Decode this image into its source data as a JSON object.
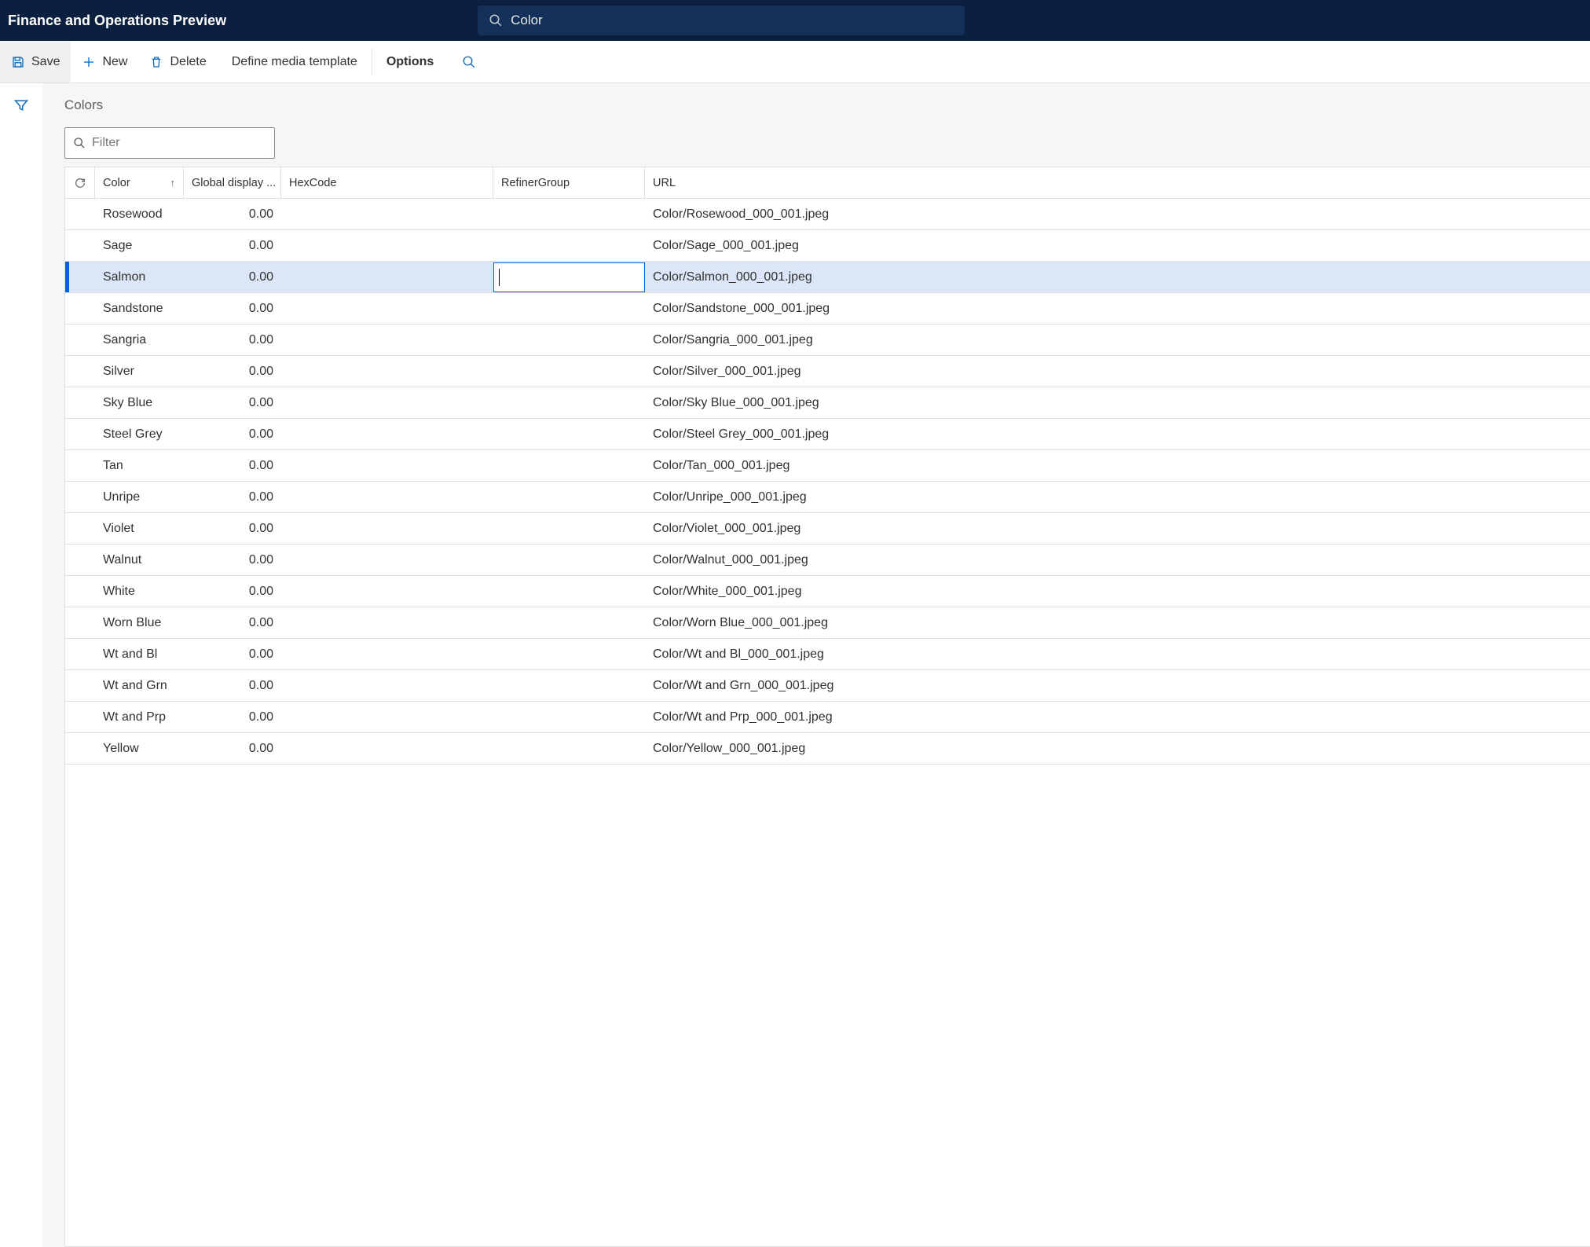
{
  "header": {
    "app_title": "Finance and Operations Preview",
    "search_value": "Color"
  },
  "actions": {
    "save": "Save",
    "new": "New",
    "delete": "Delete",
    "define_media": "Define media template",
    "options": "Options"
  },
  "page": {
    "title": "Colors",
    "filter_placeholder": "Filter"
  },
  "grid": {
    "headers": {
      "color": "Color",
      "global_display": "Global display ...",
      "hexcode": "HexCode",
      "refiner": "RefinerGroup",
      "url": "URL"
    },
    "selected_index": 2,
    "rows": [
      {
        "color": "Rosewood",
        "display": "0.00",
        "hex": "",
        "refiner": "",
        "url": "Color/Rosewood_000_001.jpeg"
      },
      {
        "color": "Sage",
        "display": "0.00",
        "hex": "",
        "refiner": "",
        "url": "Color/Sage_000_001.jpeg"
      },
      {
        "color": "Salmon",
        "display": "0.00",
        "hex": "",
        "refiner": "",
        "url": "Color/Salmon_000_001.jpeg"
      },
      {
        "color": "Sandstone",
        "display": "0.00",
        "hex": "",
        "refiner": "",
        "url": "Color/Sandstone_000_001.jpeg"
      },
      {
        "color": "Sangria",
        "display": "0.00",
        "hex": "",
        "refiner": "",
        "url": "Color/Sangria_000_001.jpeg"
      },
      {
        "color": "Silver",
        "display": "0.00",
        "hex": "",
        "refiner": "",
        "url": "Color/Silver_000_001.jpeg"
      },
      {
        "color": "Sky Blue",
        "display": "0.00",
        "hex": "",
        "refiner": "",
        "url": "Color/Sky Blue_000_001.jpeg"
      },
      {
        "color": "Steel Grey",
        "display": "0.00",
        "hex": "",
        "refiner": "",
        "url": "Color/Steel Grey_000_001.jpeg"
      },
      {
        "color": "Tan",
        "display": "0.00",
        "hex": "",
        "refiner": "",
        "url": "Color/Tan_000_001.jpeg"
      },
      {
        "color": "Unripe",
        "display": "0.00",
        "hex": "",
        "refiner": "",
        "url": "Color/Unripe_000_001.jpeg"
      },
      {
        "color": "Violet",
        "display": "0.00",
        "hex": "",
        "refiner": "",
        "url": "Color/Violet_000_001.jpeg"
      },
      {
        "color": "Walnut",
        "display": "0.00",
        "hex": "",
        "refiner": "",
        "url": "Color/Walnut_000_001.jpeg"
      },
      {
        "color": "White",
        "display": "0.00",
        "hex": "",
        "refiner": "",
        "url": "Color/White_000_001.jpeg"
      },
      {
        "color": "Worn Blue",
        "display": "0.00",
        "hex": "",
        "refiner": "",
        "url": "Color/Worn Blue_000_001.jpeg"
      },
      {
        "color": "Wt and Bl",
        "display": "0.00",
        "hex": "",
        "refiner": "",
        "url": "Color/Wt and Bl_000_001.jpeg"
      },
      {
        "color": "Wt and Grn",
        "display": "0.00",
        "hex": "",
        "refiner": "",
        "url": "Color/Wt and Grn_000_001.jpeg"
      },
      {
        "color": "Wt and Prp",
        "display": "0.00",
        "hex": "",
        "refiner": "",
        "url": "Color/Wt and Prp_000_001.jpeg"
      },
      {
        "color": "Yellow",
        "display": "0.00",
        "hex": "",
        "refiner": "",
        "url": "Color/Yellow_000_001.jpeg"
      }
    ]
  }
}
